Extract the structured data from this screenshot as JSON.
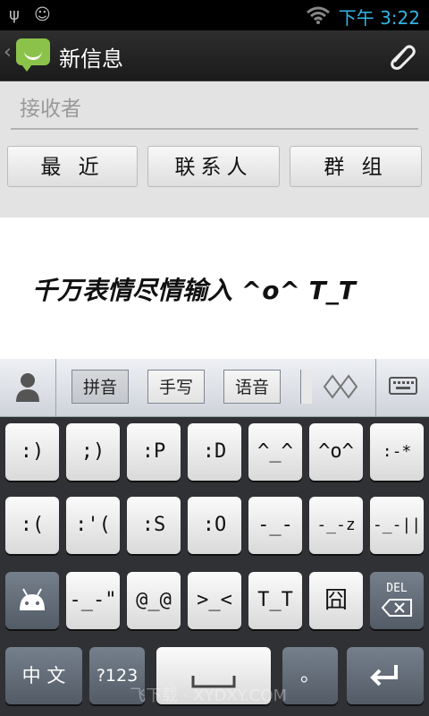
{
  "status_bar": {
    "time": "下午 3:22",
    "icons": [
      "usb-icon",
      "android-icon",
      "wifi-icon",
      "battery-icon"
    ]
  },
  "action_bar": {
    "title": "新信息",
    "attach_icon": "paperclip-icon"
  },
  "recipient": {
    "placeholder": "接收者",
    "buttons": [
      "最 近",
      "联系人",
      "群 组"
    ]
  },
  "message": {
    "text": "千万表情尽情输入 ^o^  T_T"
  },
  "keyboard": {
    "modes": [
      "拼音",
      "手写",
      "语音"
    ],
    "row1": [
      ":)",
      ";)",
      ":P",
      ":D",
      "^_^",
      "^o^",
      ":-*"
    ],
    "row2": [
      ":(",
      ":'(",
      ":S",
      ":O",
      "-_-",
      "-_-z",
      "-_-||"
    ],
    "row3": [
      "@_@",
      ">_<",
      "T_T",
      "囧"
    ],
    "row3_special": {
      "dash": "-_-\"",
      "del": "DEL"
    },
    "bottom": {
      "chinese": "中 文",
      "num": "?123",
      "period": "。"
    },
    "watermark": "飞下载 · XYDXY.COM",
    "colors": {
      "key_light": "#f0f0f0",
      "key_dark": "#5e6773",
      "background": "#2f3135"
    }
  }
}
